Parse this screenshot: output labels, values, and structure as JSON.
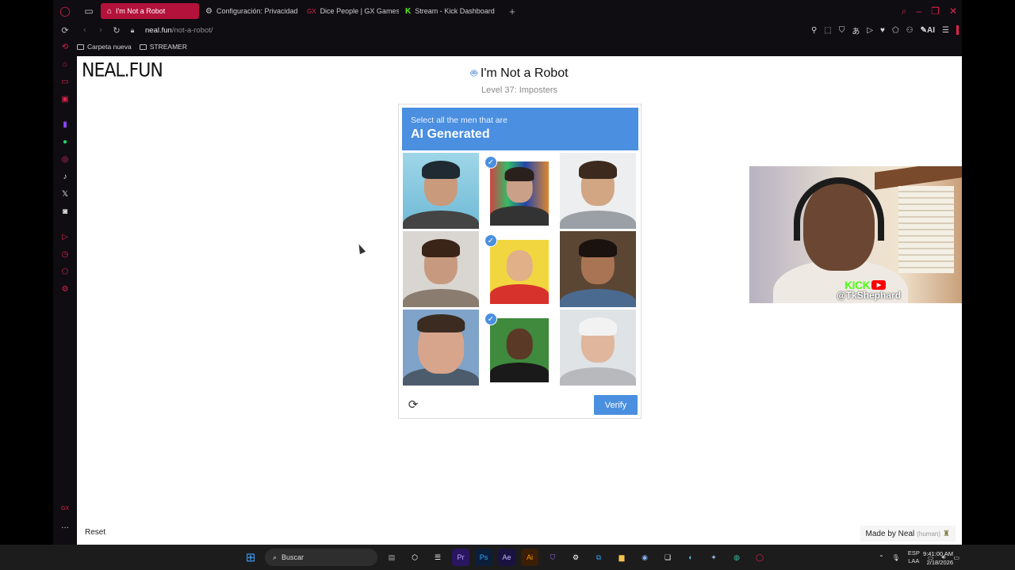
{
  "tabs": [
    {
      "label": "I'm Not a Robot",
      "icon": "robot-icon",
      "active": true
    },
    {
      "label": "Configuración: Privacidad",
      "icon": "gear-icon",
      "active": false
    },
    {
      "label": "Dice People | GX Games",
      "icon": "gx-icon",
      "active": false
    },
    {
      "label": "Stream - Kick Dashboard",
      "icon": "kick-icon",
      "active": false
    }
  ],
  "address": {
    "host": "neal.fun",
    "path": "/not-a-robot/"
  },
  "bookmarks": [
    "Carpeta nueva",
    "STREAMER"
  ],
  "page": {
    "logo": "NEAL.FUN",
    "title": "I'm Not a Robot",
    "subtitle": "Level 37: Imposters",
    "captcha": {
      "instruction": "Select all the men that are",
      "target": "AI Generated",
      "tiles": [
        {
          "selected": false,
          "desc": "man-beanie-beach"
        },
        {
          "selected": true,
          "desc": "man-glasses-posters"
        },
        {
          "selected": false,
          "desc": "smiling-man-gray-shirt"
        },
        {
          "selected": false,
          "desc": "bearded-man-curly-hair"
        },
        {
          "selected": true,
          "desc": "cartoon-eyes-man-eating"
        },
        {
          "selected": false,
          "desc": "smiling-man-denim-jacket"
        },
        {
          "selected": false,
          "desc": "man-blue-eyes-closeup"
        },
        {
          "selected": true,
          "desc": "man-suit-green-background"
        },
        {
          "selected": false,
          "desc": "old-man-laptop-mug"
        }
      ],
      "verify_label": "Verify"
    },
    "reset_label": "Reset",
    "made_by": "Made by Neal",
    "made_by_suffix": "(human)"
  },
  "webcam": {
    "brand": "KICK",
    "handle": "@TkShephard"
  },
  "taskbar": {
    "search_placeholder": "Buscar",
    "lang_top": "ESP",
    "lang_bottom": "LAA",
    "time": "9:41:00 AM",
    "date": "2/18/2026"
  },
  "colors": {
    "accent": "#4a8fe0",
    "opera_red": "#e0234e",
    "tab_active": "#b3123b"
  }
}
